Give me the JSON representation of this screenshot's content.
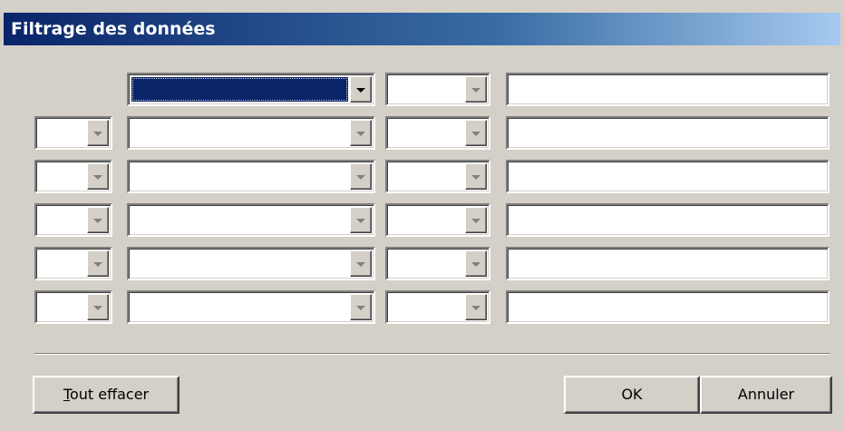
{
  "window": {
    "title": "Filtrage des données"
  },
  "criteria_rows": [
    {
      "connector": null,
      "field": "",
      "field_selected": true,
      "condition": "",
      "value": ""
    },
    {
      "connector": "",
      "field": "",
      "field_selected": false,
      "condition": "",
      "value": ""
    },
    {
      "connector": "",
      "field": "",
      "field_selected": false,
      "condition": "",
      "value": ""
    },
    {
      "connector": "",
      "field": "",
      "field_selected": false,
      "condition": "",
      "value": ""
    },
    {
      "connector": "",
      "field": "",
      "field_selected": false,
      "condition": "",
      "value": ""
    },
    {
      "connector": "",
      "field": "",
      "field_selected": false,
      "condition": "",
      "value": ""
    }
  ],
  "buttons": {
    "clear_all_mnemonic": "T",
    "clear_all_rest": "out effacer",
    "ok": "OK",
    "cancel": "Annuler"
  },
  "icons": {
    "dropdown": "chevron-down-icon"
  }
}
